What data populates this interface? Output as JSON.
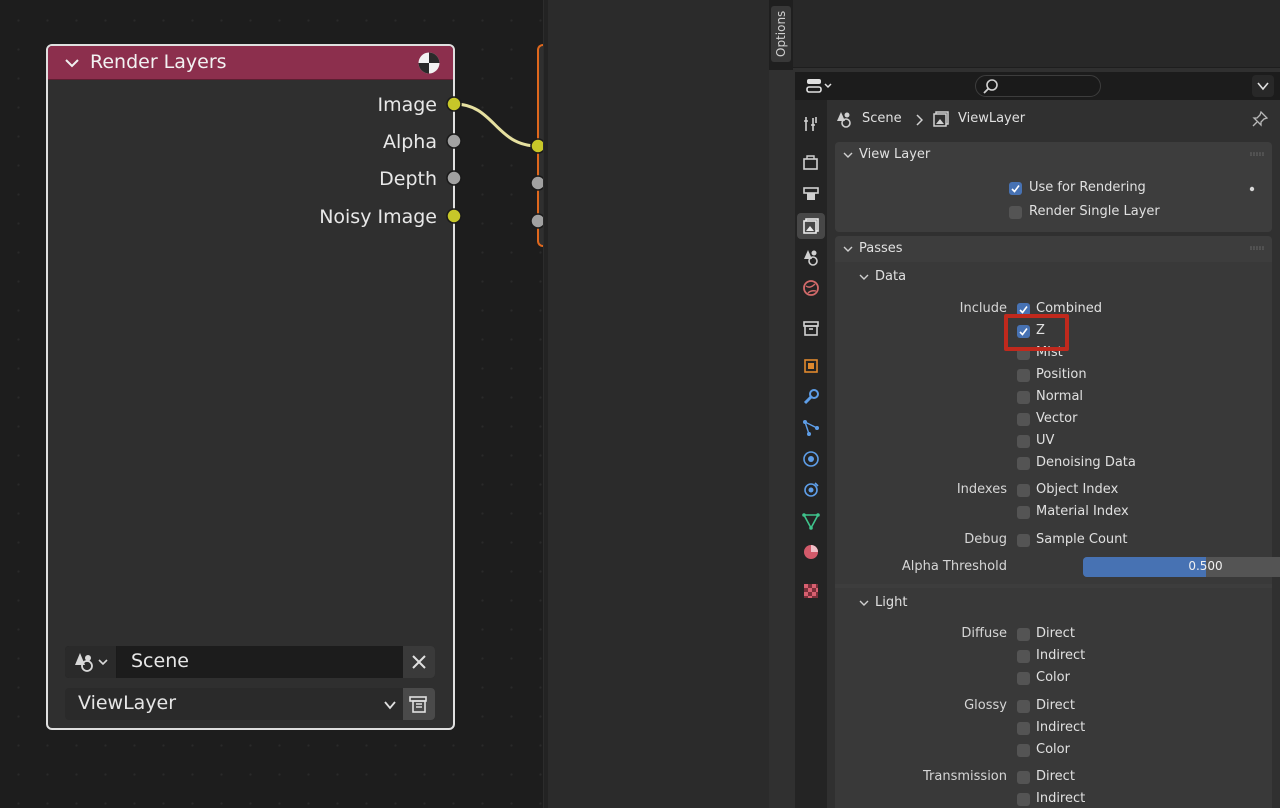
{
  "node": {
    "title": "Render Layers",
    "sockets": [
      "Image",
      "Alpha",
      "Depth",
      "Noisy Image"
    ],
    "scene_value": "Scene",
    "view_layer_value": "ViewLayer"
  },
  "properties": {
    "options_tab": "Options",
    "breadcrumb": {
      "scene": "Scene",
      "view_layer": "ViewLayer"
    },
    "view_layer_panel": {
      "title": "View Layer",
      "use_for_rendering": "Use for Rendering",
      "render_single_layer": "Render Single Layer"
    },
    "passes_panel": {
      "title": "Passes",
      "data_sub": "Data",
      "include_label": "Include",
      "include": [
        "Combined",
        "Z",
        "Mist",
        "Position",
        "Normal",
        "Vector",
        "UV",
        "Denoising Data"
      ],
      "indexes_label": "Indexes",
      "indexes": [
        "Object Index",
        "Material Index"
      ],
      "debug_label": "Debug",
      "debug": [
        "Sample Count"
      ],
      "alpha_label": "Alpha Threshold",
      "alpha_value": "0.500",
      "alpha_fraction": 0.5,
      "light_sub": "Light",
      "diffuse_label": "Diffuse",
      "diffuse": [
        "Direct",
        "Indirect",
        "Color"
      ],
      "glossy_label": "Glossy",
      "glossy": [
        "Direct",
        "Indirect",
        "Color"
      ],
      "transmission_label": "Transmission",
      "transmission": [
        "Direct",
        "Indirect"
      ]
    }
  },
  "colors": {
    "node_header": "#8c2f4d",
    "socket_yellow": "#c7c729",
    "socket_gray": "#a1a1a1",
    "accent_blue": "#4772b3",
    "highlight_red": "#c0291d"
  }
}
